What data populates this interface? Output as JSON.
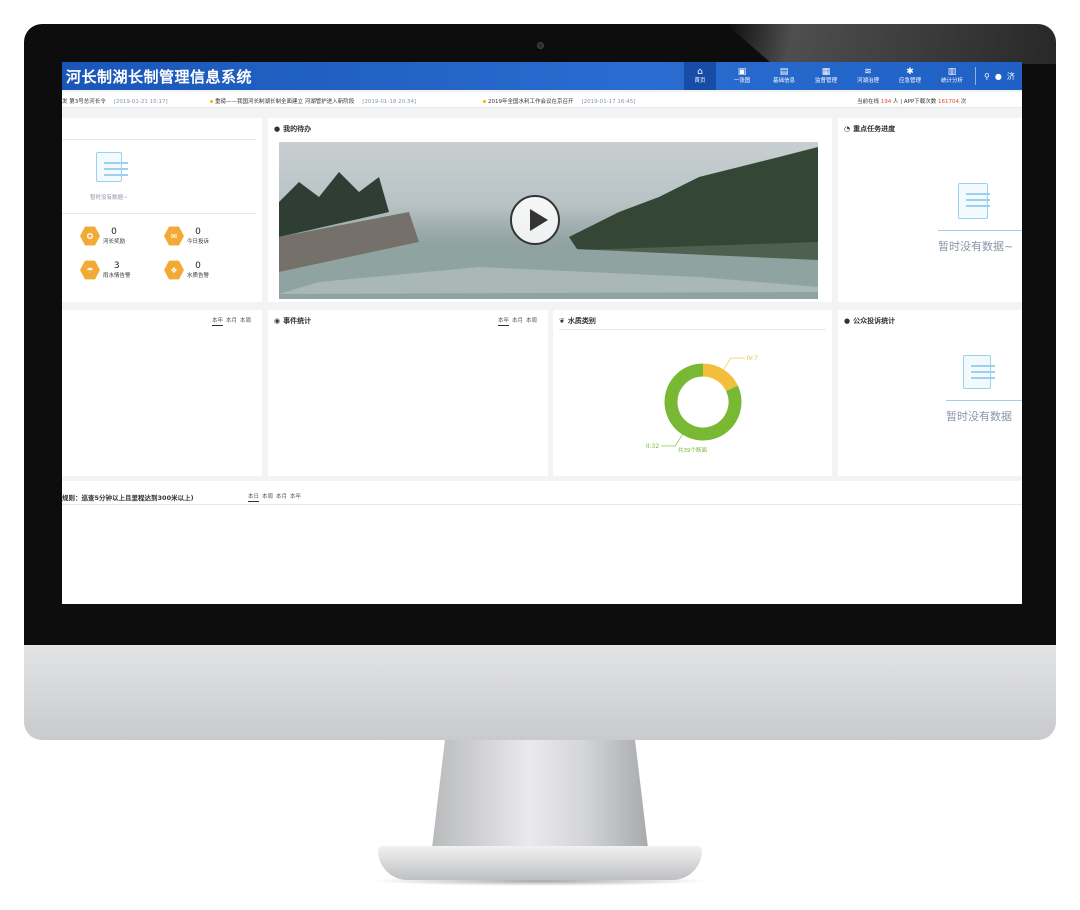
{
  "header": {
    "title": "河长制湖长制管理信息系统",
    "nav": [
      {
        "icon": "home-icon",
        "label": "首页",
        "active": true
      },
      {
        "icon": "map-icon",
        "label": "一张图",
        "active": false
      },
      {
        "icon": "document-icon",
        "label": "基础信息",
        "active": false
      },
      {
        "icon": "monitor-icon",
        "label": "监督管理",
        "active": false
      },
      {
        "icon": "river-icon",
        "label": "河湖治理",
        "active": false
      },
      {
        "icon": "alarm-icon",
        "label": "应急管理",
        "active": false
      },
      {
        "icon": "chart-icon",
        "label": "统计分析",
        "active": false
      }
    ],
    "tools": {
      "search_icon": "search-icon",
      "user_icon": "user-icon",
      "user_text": "济"
    }
  },
  "ticker": {
    "items": [
      {
        "text": "发 第3号总河长令",
        "date": "[2019-01-21 15:17]"
      },
      {
        "text": "重磅——我国河长制湖长制全面建立 河湖管护进入新阶段",
        "date": "[2019-01-18 20:34]"
      },
      {
        "text": "2019年全国水利工作会议在京召开",
        "date": "[2019-01-17 16:45]"
      }
    ],
    "online_label": "当前在线",
    "online_count": "194",
    "online_unit": "人",
    "download_label": "APP下载次数",
    "download_count": "161704",
    "download_unit": "次"
  },
  "left_panel": {
    "empty_text": "暂时没有数据~",
    "stats": [
      {
        "value": "0",
        "label": "河长奖励"
      },
      {
        "value": "0",
        "label": "今日投诉"
      },
      {
        "value": "3",
        "label": "雨水情告警"
      },
      {
        "value": "0",
        "label": "水质告警"
      }
    ]
  },
  "todo": {
    "title": "我的待办"
  },
  "key_tasks": {
    "title": "重点任务进度",
    "empty_text": "暂时没有数据~"
  },
  "periods": {
    "year": "本年",
    "month": "本月",
    "week": "本周",
    "day": "本日"
  },
  "event_stats": {
    "title": "事件统计"
  },
  "water_quality": {
    "title": "水质类别",
    "total_text": "共39个断面"
  },
  "complaints": {
    "title": "公众投诉统计",
    "empty_text": "暂时没有数据"
  },
  "patrol": {
    "rule_text": "规则：巡查5分钟以上且里程达到300米以上)"
  },
  "chart_data": {
    "type": "pie",
    "title": "",
    "categories": [
      "IV:7",
      "II:32"
    ],
    "values": [
      7,
      32
    ],
    "colors": [
      "#f2bf3c",
      "#78b832"
    ],
    "donut": true
  }
}
